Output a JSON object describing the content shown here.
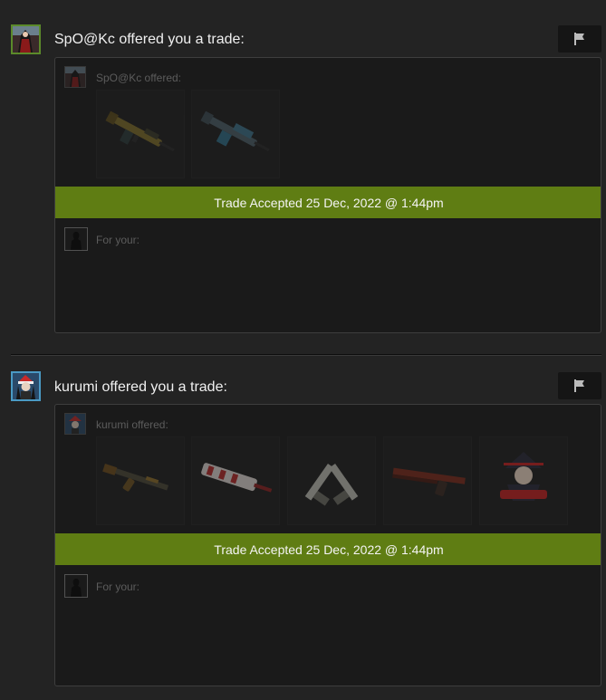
{
  "offers": [
    {
      "header": "SpO@Kc offered you a trade:",
      "offered_label": "SpO@Kc offered:",
      "status": "Trade Accepted 25 Dec, 2022 @ 1:44pm",
      "for_your_label": "For your:",
      "items": [
        "machine-gun-green",
        "machine-gun-blue"
      ]
    },
    {
      "header": "kurumi offered you a trade:",
      "offered_label": "kurumi offered:",
      "status": "Trade Accepted 25 Dec, 2022 @ 1:44pm",
      "for_your_label": "For your:",
      "items": [
        "ak-rifle",
        "rifle-red-white",
        "dual-pistols",
        "pistol-red",
        "sticker-graffiti"
      ]
    }
  ],
  "colors": {
    "accent_banner": "#5f7d13",
    "avatar_border_green": "#5b8a2a",
    "avatar_border_blue": "#4a9ac4"
  },
  "icons": {
    "report": "flag-icon"
  }
}
